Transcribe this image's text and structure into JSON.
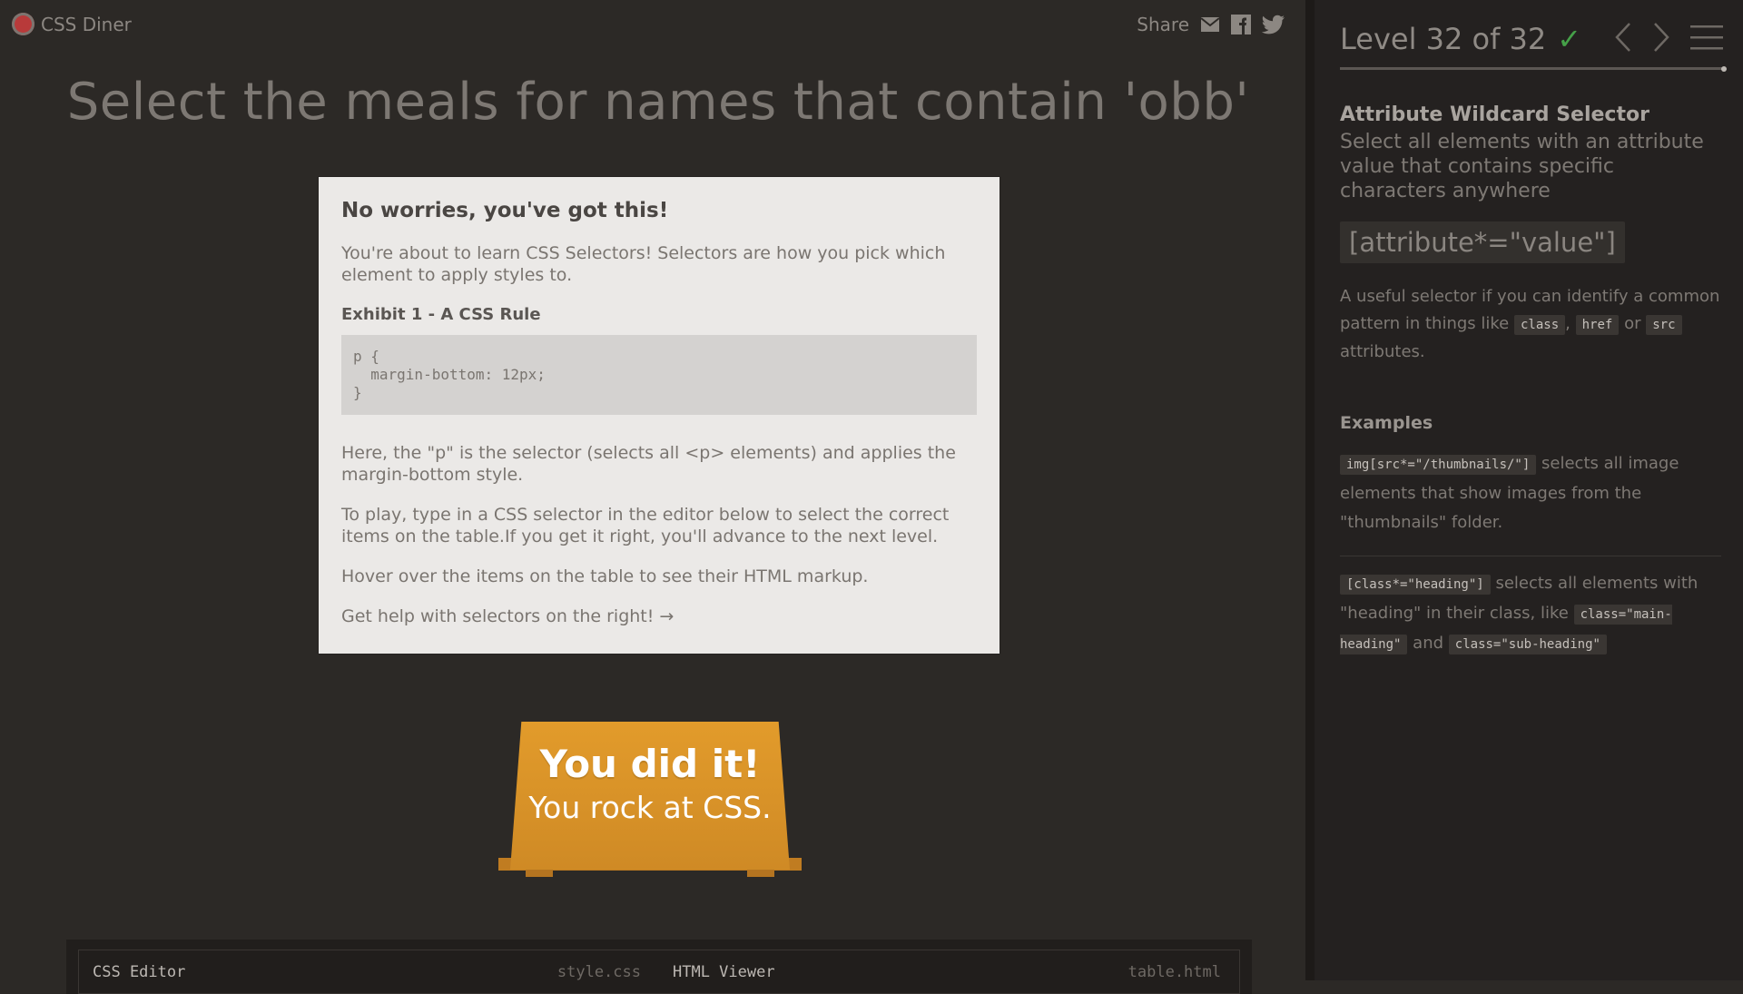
{
  "app": {
    "title": "CSS Diner"
  },
  "share": {
    "label": "Share",
    "icons": [
      "mail-icon",
      "facebook-icon",
      "twitter-icon"
    ]
  },
  "order": "Select the meals for names that contain 'obb'",
  "modal": {
    "heading": "No worries, you've got this!",
    "intro": "You're about to learn CSS Selectors! Selectors are how you pick which element to apply styles to.",
    "exhibit": "Exhibit 1 - A CSS Rule",
    "code": "p {\n  margin-bottom: 12px;\n}",
    "explain": "Here, the \"p\" is the selector (selects all <p> elements) and applies the margin-bottom style.",
    "play": "To play, type in a CSS selector in the editor below to select the correct items on the table.If you get it right, you'll advance to the next level.",
    "hover": "Hover over the items on the table to see their HTML markup.",
    "help": "Get help with selectors on the right! →"
  },
  "table": {
    "title": "You did it!",
    "subtitle": "You rock at CSS."
  },
  "editor": {
    "css_label": "CSS Editor",
    "css_file": "style.css",
    "html_label": "HTML Viewer",
    "html_file": "table.html"
  },
  "level": {
    "label": "Level 32 of 32",
    "check": "✓",
    "current": 32,
    "total": 32,
    "completed": true
  },
  "help": {
    "title": "Attribute Wildcard Selector",
    "description": "Select all elements with an attribute value that contains specific characters anywhere",
    "syntax": "[attribute*=\"value\"]",
    "hint_text1": "A useful selector if you can identify a common pattern in things like",
    "hint_code1": "class",
    "hint_sep": ",",
    "hint_code2": "href",
    "hint_or": "or",
    "hint_code3": "src",
    "hint_text2": "attributes.",
    "examples_title": "Examples",
    "ex1_code": "img[src*=\"/thumbnails/\"]",
    "ex1_text": "selects all image elements that show images from the \"thumbnails\" folder.",
    "ex2_code": "[class*=\"heading\"]",
    "ex2_text": "selects all elements with \"heading\" in their class, like",
    "ex2_code2": "class=\"main-heading\"",
    "ex2_and": "and",
    "ex2_code3": "class=\"sub-heading\""
  },
  "colors": {
    "background": "#2c2926",
    "sidebar": "#242120",
    "modal": "#ebe9e7",
    "table": "#e29b2b",
    "check": "#45a048",
    "logo": "#b83a3a"
  }
}
